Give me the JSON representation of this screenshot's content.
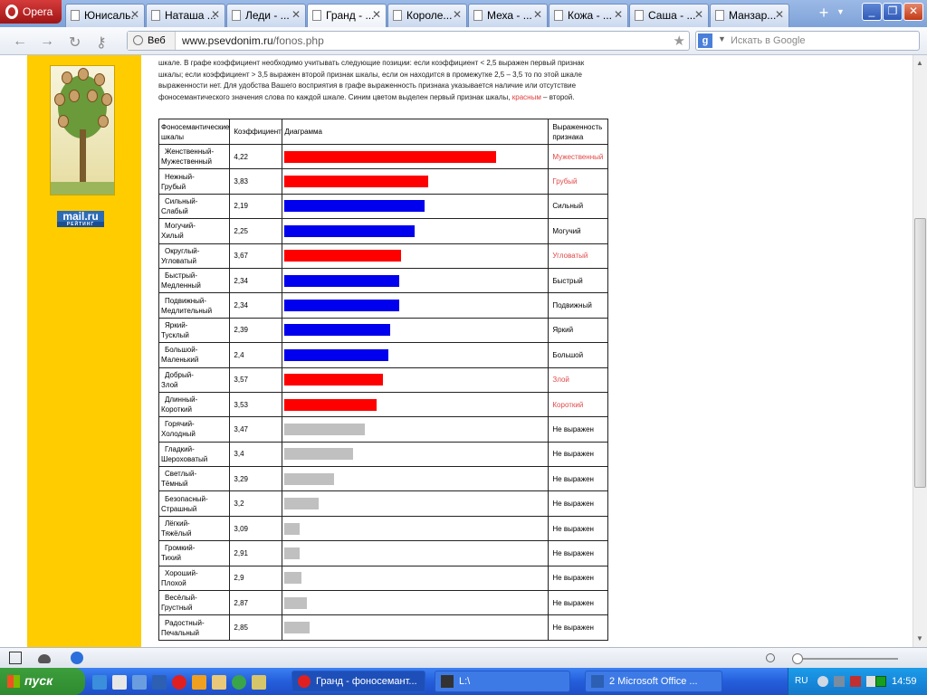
{
  "browser": {
    "menu_label": "Opera",
    "tabs": [
      {
        "label": "Юнисаль..."
      },
      {
        "label": "Наташа ..."
      },
      {
        "label": "Леди - ..."
      },
      {
        "label": "Гранд - ..."
      },
      {
        "label": "Короле..."
      },
      {
        "label": "Меха - ..."
      },
      {
        "label": "Кожа - ..."
      },
      {
        "label": "Саша - ..."
      },
      {
        "label": "Манзар..."
      }
    ],
    "active_tab": 3,
    "address": {
      "badge": "Веб",
      "host": "www.psevdonim.ru",
      "path": "/fonos.php"
    },
    "search_placeholder": "Искать в Google"
  },
  "page": {
    "intro": {
      "text1": "шкале. В графе коэффициент необходимо учитывать следующие позиции: если коэффициент < 2,5 выражен первый признак шкалы; если коэффициент > 3,5 выражен второй признак шкалы, если он находится в промежутке 2,5 – 3,5 то по этой шкале выраженности нет. Для удобства Вашего восприятия в графе выраженность признака указывается наличие или отсутствие фоносемантического значения слова по каждой шкале. Синим цветом выделен первый признак шкалы, ",
      "red_word": "красным",
      "text2": " – второй."
    },
    "mailru_logo": {
      "top": "mail.ru",
      "bottom": "РЕЙТИНГ"
    },
    "table_headers": {
      "scale": "Фоносемантические шкалы",
      "coef": "Коэффициент",
      "diagram": "Диаграмма",
      "expression": "Выраженность признака"
    },
    "rows": [
      {
        "s1": "Женственный-",
        "s2": "Мужественный",
        "coef": "4,22",
        "value": 4.22,
        "bar": "red",
        "expr": "Мужественный"
      },
      {
        "s1": "Нежный-",
        "s2": "Грубый",
        "coef": "3,83",
        "value": 3.83,
        "bar": "red",
        "expr": "Грубый"
      },
      {
        "s1": "Сильный-",
        "s2": "Слабый",
        "coef": "2,19",
        "value": 2.19,
        "bar": "blue",
        "expr": "Сильный"
      },
      {
        "s1": "Могучий-",
        "s2": "Хилый",
        "coef": "2,25",
        "value": 2.25,
        "bar": "blue",
        "expr": "Могучий"
      },
      {
        "s1": "Округлый-",
        "s2": "Угловатый",
        "coef": "3,67",
        "value": 3.67,
        "bar": "red",
        "expr": "Угловатый"
      },
      {
        "s1": "Быстрый-",
        "s2": "Медленный",
        "coef": "2,34",
        "value": 2.34,
        "bar": "blue",
        "expr": "Быстрый"
      },
      {
        "s1": "Подвижный-",
        "s2": "Медлительный",
        "coef": "2,34",
        "value": 2.34,
        "bar": "blue",
        "expr": "Подвижный"
      },
      {
        "s1": "Яркий-",
        "s2": "Тусклый",
        "coef": "2,39",
        "value": 2.39,
        "bar": "blue",
        "expr": "Яркий"
      },
      {
        "s1": "Большой-",
        "s2": "Маленький",
        "coef": "2,4",
        "value": 2.4,
        "bar": "blue",
        "expr": "Большой"
      },
      {
        "s1": "Добрый-",
        "s2": "Злой",
        "coef": "3,57",
        "value": 3.57,
        "bar": "red",
        "expr": "Злой"
      },
      {
        "s1": "Длинный-",
        "s2": "Короткий",
        "coef": "3,53",
        "value": 3.53,
        "bar": "red",
        "expr": "Короткий"
      },
      {
        "s1": "Горячий-",
        "s2": "Холодный",
        "coef": "3,47",
        "value": 3.47,
        "bar": "gray",
        "expr": "Не выражен"
      },
      {
        "s1": "Гладкий-",
        "s2": "Шероховатый",
        "coef": "3,4",
        "value": 3.4,
        "bar": "gray",
        "expr": "Не выражен"
      },
      {
        "s1": "Светлый-",
        "s2": "Тёмный",
        "coef": "3,29",
        "value": 3.29,
        "bar": "gray",
        "expr": "Не выражен"
      },
      {
        "s1": "Безопасный-",
        "s2": "Страшный",
        "coef": "3,2",
        "value": 3.2,
        "bar": "gray",
        "expr": "Не выражен"
      },
      {
        "s1": "Лёгкий-",
        "s2": "Тяжёлый",
        "coef": "3,09",
        "value": 3.09,
        "bar": "gray",
        "expr": "Не выражен"
      },
      {
        "s1": "Громкий-",
        "s2": "Тихий",
        "coef": "2,91",
        "value": 2.91,
        "bar": "gray",
        "expr": "Не выражен"
      },
      {
        "s1": "Хороший-",
        "s2": "Плохой",
        "coef": "2,9",
        "value": 2.9,
        "bar": "gray",
        "expr": "Не выражен"
      },
      {
        "s1": "Весёлый-",
        "s2": "Грустный",
        "coef": "2,87",
        "value": 2.87,
        "bar": "gray",
        "expr": "Не выражен"
      },
      {
        "s1": "Радостный-",
        "s2": "Печальный",
        "coef": "2,85",
        "value": 2.85,
        "bar": "gray",
        "expr": "Не выражен"
      }
    ]
  },
  "colors": {
    "red": "#ff0000",
    "blue": "#0000ee",
    "gray": "#c0c0c0",
    "red_text": "#e04848",
    "sidebar": "#ffcc00"
  },
  "taskbar": {
    "start_label": "пуск",
    "tasks": [
      {
        "label": "Гранд - фоносемант..."
      },
      {
        "label": "L:\\"
      },
      {
        "label": "2 Microsoft Office ..."
      }
    ],
    "lang": "RU",
    "clock": "14:59"
  }
}
